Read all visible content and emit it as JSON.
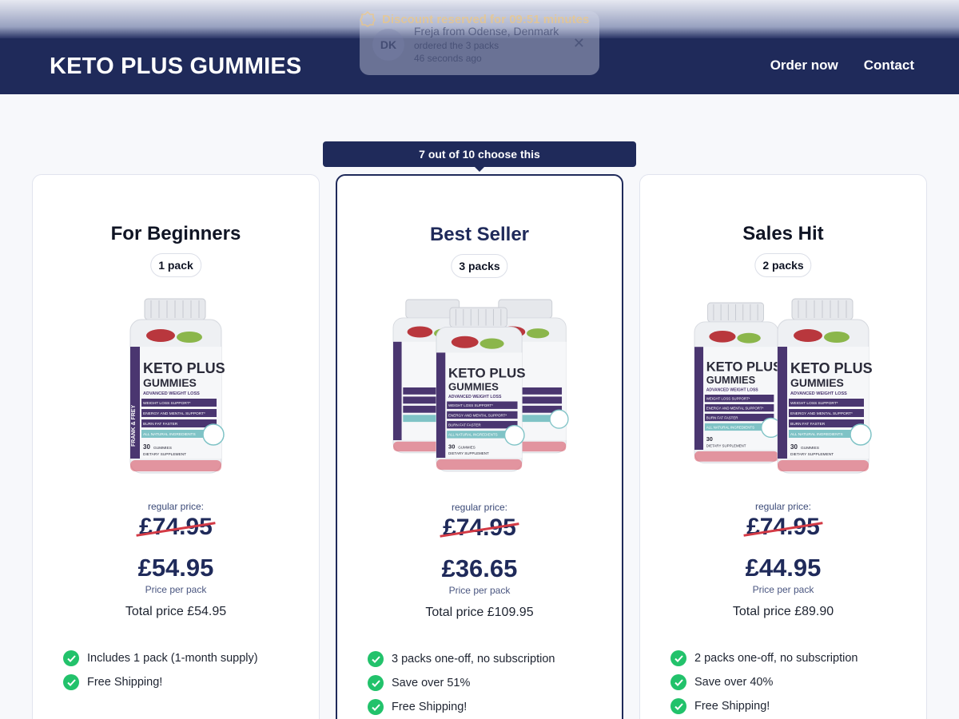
{
  "discount": {
    "text": "Discount reserved for 09:51 minutes"
  },
  "header": {
    "brand": "KETO PLUS GUMMIES",
    "nav": [
      {
        "label": "Order now"
      },
      {
        "label": "Contact"
      }
    ]
  },
  "notification": {
    "initials": "DK",
    "name": "Freja from Odense, Denmark",
    "action": "ordered the 3 packs",
    "time": "46 seconds ago",
    "close": "✕"
  },
  "banner": {
    "text": "7 out of 10 choose this"
  },
  "product_label": {
    "brand_side": "FRANK & FREY",
    "line1": "KETO PLUS",
    "line2": "GUMMIES",
    "subtitle": "ADVANCED WEIGHT LOSS",
    "benefits": [
      "WEIGHT LOSS SUPPORT*",
      "ENERGY AND MENTAL SUPPORT*",
      "BURN FAT FASTER",
      "ALL NATURAL INGREDIENTS"
    ],
    "count": "30",
    "count_unit": "GUMMIES",
    "supplement": "DIETARY SUPPLEMENT"
  },
  "cards": [
    {
      "title": "For Beginners",
      "packs": "1 pack",
      "regular_label": "regular price:",
      "old_price": "£74.95",
      "price": "£54.95",
      "per_pack": "Price per pack",
      "total": "Total price £54.95",
      "features": [
        "Includes 1 pack (1-month supply)",
        "Free Shipping!"
      ]
    },
    {
      "title": "Best Seller",
      "packs": "3 packs",
      "regular_label": "regular price:",
      "old_price": "£74.95",
      "price": "£36.65",
      "per_pack": "Price per pack",
      "total": "Total price £109.95",
      "features": [
        "3 packs one-off, no subscription",
        "Save over 51%",
        "Free Shipping!"
      ]
    },
    {
      "title": "Sales Hit",
      "packs": "2 packs",
      "regular_label": "regular price:",
      "old_price": "£74.95",
      "price": "£44.95",
      "per_pack": "Price per pack",
      "total": "Total price £89.90",
      "features": [
        "2 packs one-off, no subscription",
        "Save over 40%",
        "Free Shipping!"
      ]
    }
  ],
  "colors": {
    "navy": "#1f2a5a",
    "check_green": "#22c26b",
    "strike_red": "#d33a45",
    "label_purple": "#4a3670",
    "label_teal": "#7fc3c6"
  },
  "icons": {
    "check": "check-icon",
    "discount": "discount-badge-icon",
    "close": "close-icon"
  }
}
